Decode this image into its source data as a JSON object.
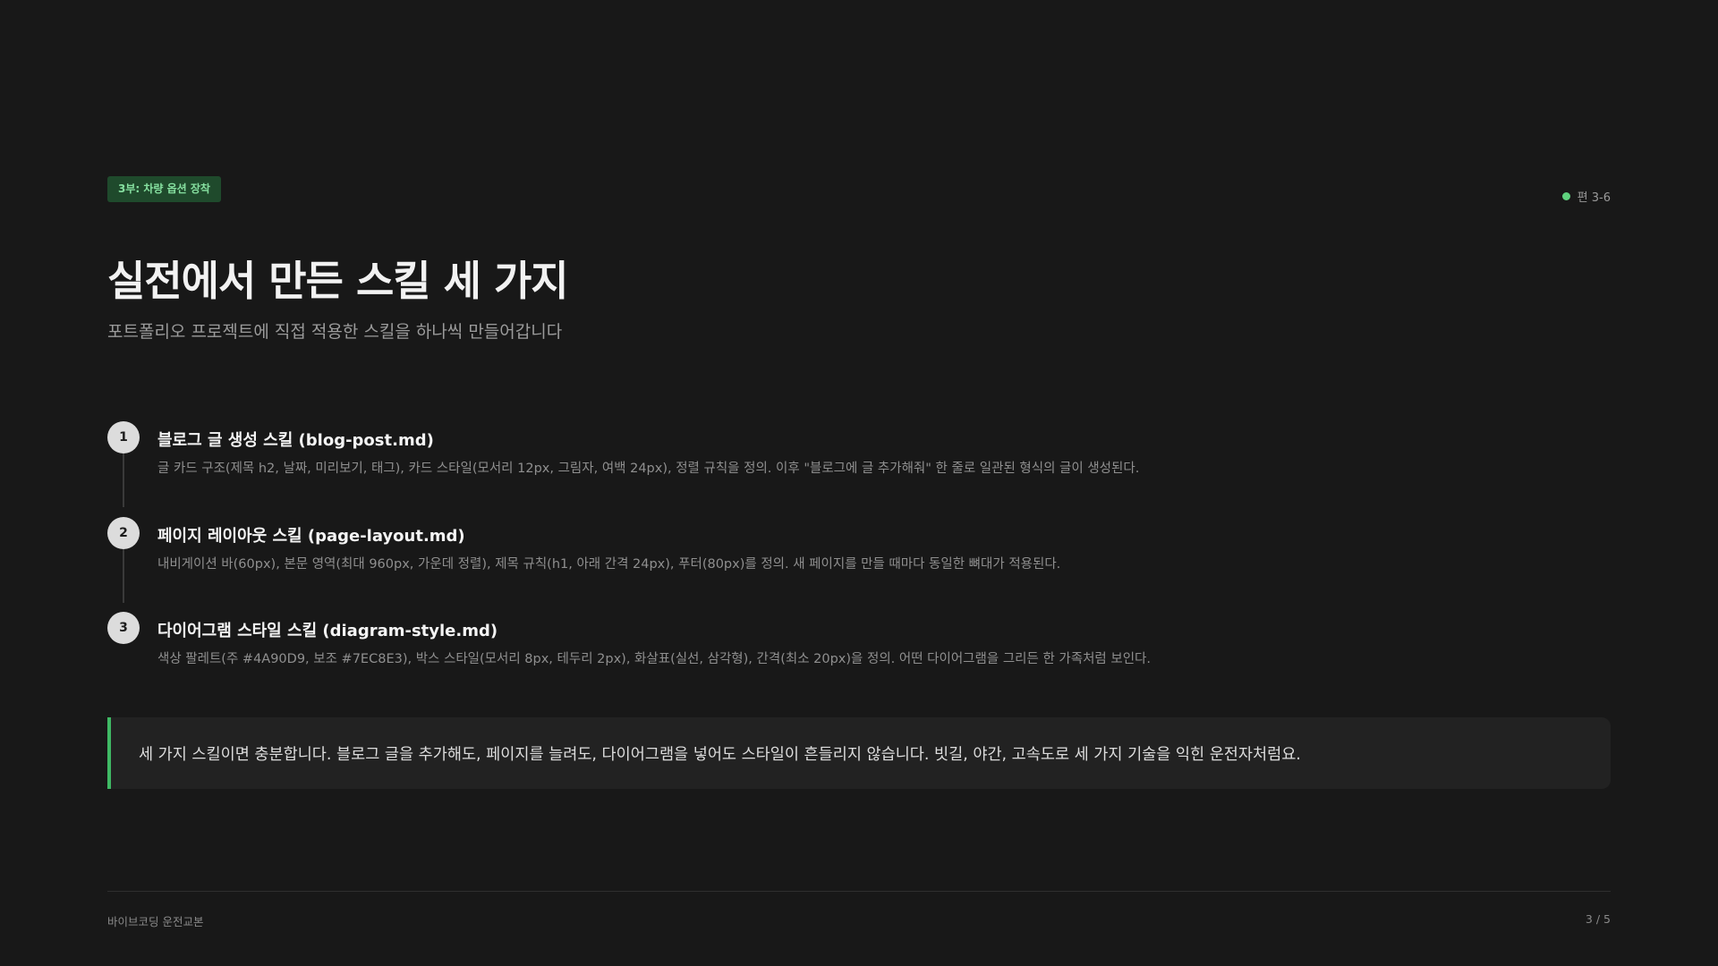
{
  "header": {
    "badge": "3부: 차량 옵션 장착",
    "episode": "편 3-6",
    "episode_dot_color": "#5fd27e"
  },
  "main": {
    "title": "실전에서 만든 스킬 세 가지",
    "subtitle": "포트폴리오 프로젝트에 직접 적용한 스킬을 하나씩 만들어갑니다",
    "steps": [
      {
        "number": "1",
        "title": "블로그 글 생성 스킬 (blog-post.md)",
        "description": "글 카드 구조(제목 h2, 날짜, 미리보기, 태그), 카드 스타일(모서리 12px, 그림자, 여백 24px), 정렬 규칙을 정의. 이후 \"블로그에 글 추가해줘\" 한 줄로 일관된 형식의 글이 생성된다."
      },
      {
        "number": "2",
        "title": "페이지 레이아웃 스킬 (page-layout.md)",
        "description": "내비게이션 바(60px), 본문 영역(최대 960px, 가운데 정렬), 제목 규칙(h1, 아래 간격 24px), 푸터(80px)를 정의. 새 페이지를 만들 때마다 동일한 뼈대가 적용된다."
      },
      {
        "number": "3",
        "title": "다이어그램 스타일 스킬 (diagram-style.md)",
        "description": "색상 팔레트(주 #4A90D9, 보조 #7EC8E3), 박스 스타일(모서리 8px, 테두리 2px), 화살표(실선, 삼각형), 간격(최소 20px)을 정의. 어떤 다이어그램을 그리든 한 가족처럼 보인다."
      }
    ],
    "callout": "세 가지 스킬이면 충분합니다. 블로그 글을 추가해도, 페이지를 늘려도, 다이어그램을 넣어도 스타일이 흔들리지 않습니다. 빗길, 야간, 고속도로 세 가지 기술을 익힌 운전자처럼요.",
    "callout_accent_color": "#3fb964"
  },
  "footer": {
    "left": "바이브코딩 운전교본",
    "right": "3 / 5"
  }
}
